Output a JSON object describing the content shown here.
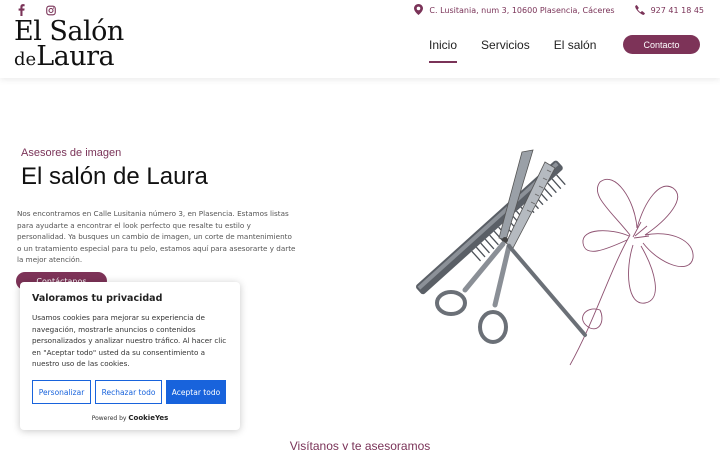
{
  "header": {
    "address": "C. Lusitania, num 3, 10600 Plasencia, Cáceres",
    "phone": "927 41 18 45",
    "logo": {
      "line1": "El Salón",
      "de": "de",
      "laura": "Laura"
    },
    "nav": [
      "Inicio",
      "Servicios",
      "El salón"
    ],
    "contact_label": "Contacto",
    "social_icons": [
      "facebook-icon",
      "instagram-icon"
    ]
  },
  "hero": {
    "eyebrow": "Asesores de imagen",
    "title": "El salón de Laura",
    "text": "Nos encontramos en Calle Lusitania número 3, en Plasencia. Estamos listas para ayudarte a encontrar el look perfecto que resalte tu estilo y personalidad. Ya busques un cambio de imagen, un corte de mantenimiento o un tratamiento especial para tu pelo, estamos aquí para asesorarte y darte la mejor atención.",
    "cta_label": "Contáctanos"
  },
  "section": {
    "title": "Visítanos y te asesoramos"
  },
  "cookie": {
    "title": "Valoramos tu privacidad",
    "text": "Usamos cookies para mejorar su experiencia de navegación, mostrarle anuncios o contenidos personalizados y analizar nuestro tráfico. Al hacer clic en \"Aceptar todo\" usted da su consentimiento a nuestro uso de las cookies.",
    "customize_label": "Personalizar",
    "reject_label": "Rechazar todo",
    "accept_label": "Aceptar todo",
    "powered_by": "Powered by",
    "brand": "CookieYes"
  },
  "colors": {
    "accent": "#7d3358",
    "cookie_blue": "#1863dc"
  }
}
